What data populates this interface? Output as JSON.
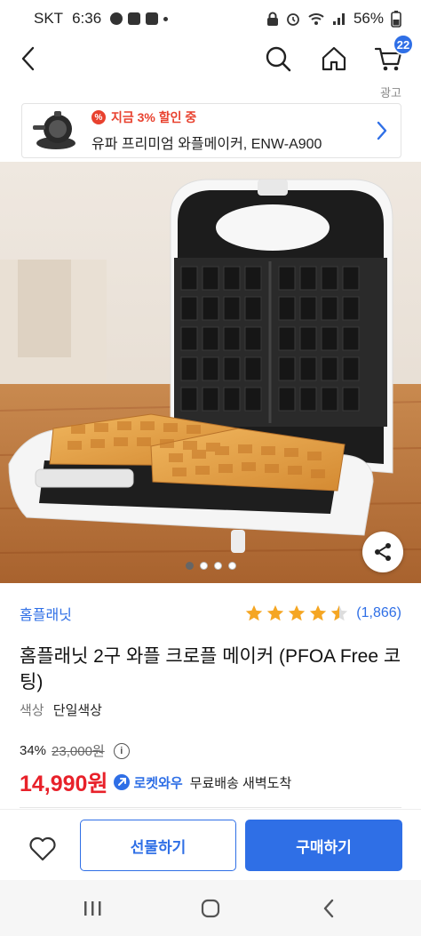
{
  "status_bar": {
    "carrier": "SKT",
    "time": "6:36",
    "battery": "56%"
  },
  "nav": {
    "cart_count": "22"
  },
  "ad": {
    "label": "광고",
    "promo": "지금 3% 할인 중",
    "title": "유파 프리미엄 와플메이커, ENW-A900"
  },
  "product": {
    "brand": "홈플래닛",
    "rating": 4.5,
    "review_count": "(1,866)",
    "title": "홈플래닛 2구 와플 크로플 메이커 (PFOA Free 코팅)",
    "option_label": "색상",
    "option_value": "단일색상",
    "discount_rate": "34%",
    "original_price": "23,000원",
    "sale_price": "14,990원",
    "rocket_label": "로켓와우",
    "delivery": "무료배송 새벽도착"
  },
  "carousel": {
    "count": 4,
    "active_index": 0
  },
  "bottom_bar": {
    "gift_label": "선물하기",
    "buy_label": "구매하기"
  },
  "colors": {
    "accent": "#2f6fe6",
    "price_red": "#e8212a",
    "star": "#f5a623"
  }
}
